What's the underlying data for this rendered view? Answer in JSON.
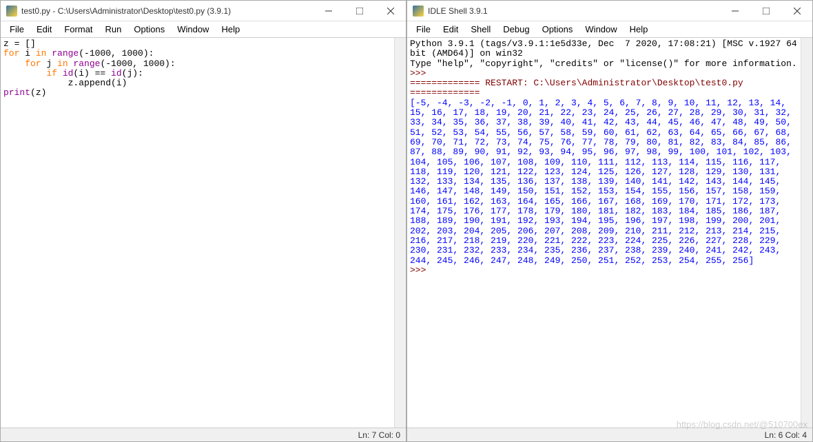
{
  "left_window": {
    "title": "test0.py - C:\\Users\\Administrator\\Desktop\\test0.py (3.9.1)",
    "menu": [
      "File",
      "Edit",
      "Format",
      "Run",
      "Options",
      "Window",
      "Help"
    ],
    "status": "Ln: 7  Col: 0",
    "code": {
      "l1": {
        "a": "z = []"
      },
      "l2": {
        "a": "for",
        "b": " i ",
        "c": "in",
        "d": " range",
        "e": "(-1000, 1000):"
      },
      "l3": {
        "a": "    for",
        "b": " j ",
        "c": "in",
        "d": " range",
        "e": "(-1000, 1000):"
      },
      "l4": {
        "a": "        if",
        "b": " id",
        "c": "(i) == ",
        "d": "id",
        "e": "(j):"
      },
      "l5": {
        "a": "            z.append(i)"
      },
      "l6": {
        "a": "print",
        "b": "(z)"
      }
    }
  },
  "right_window": {
    "title": "IDLE Shell 3.9.1",
    "menu": [
      "File",
      "Edit",
      "Shell",
      "Debug",
      "Options",
      "Window",
      "Help"
    ],
    "status": "Ln: 6  Col: 4",
    "banner_l1": "Python 3.9.1 (tags/v3.9.1:1e5d33e, Dec  7 2020, 17:08:21) [MSC v.1927 64 bit (AMD64)] on win32",
    "banner_l2": "Type \"help\", \"copyright\", \"credits\" or \"license()\" for more information.",
    "prompt": ">>>",
    "restart_label": "============= RESTART: C:\\Users\\Administrator\\Desktop\\test0.py =============",
    "output": "[-5, -4, -3, -2, -1, 0, 1, 2, 3, 4, 5, 6, 7, 8, 9, 10, 11, 12, 13, 14, 15, 16, 17, 18, 19, 20, 21, 22, 23, 24, 25, 26, 27, 28, 29, 30, 31, 32, 33, 34, 35, 36, 37, 38, 39, 40, 41, 42, 43, 44, 45, 46, 47, 48, 49, 50, 51, 52, 53, 54, 55, 56, 57, 58, 59, 60, 61, 62, 63, 64, 65, 66, 67, 68, 69, 70, 71, 72, 73, 74, 75, 76, 77, 78, 79, 80, 81, 82, 83, 84, 85, 86, 87, 88, 89, 90, 91, 92, 93, 94, 95, 96, 97, 98, 99, 100, 101, 102, 103, 104, 105, 106, 107, 108, 109, 110, 111, 112, 113, 114, 115, 116, 117, 118, 119, 120, 121, 122, 123, 124, 125, 126, 127, 128, 129, 130, 131, 132, 133, 134, 135, 136, 137, 138, 139, 140, 141, 142, 143, 144, 145, 146, 147, 148, 149, 150, 151, 152, 153, 154, 155, 156, 157, 158, 159, 160, 161, 162, 163, 164, 165, 166, 167, 168, 169, 170, 171, 172, 173, 174, 175, 176, 177, 178, 179, 180, 181, 182, 183, 184, 185, 186, 187, 188, 189, 190, 191, 192, 193, 194, 195, 196, 197, 198, 199, 200, 201, 202, 203, 204, 205, 206, 207, 208, 209, 210, 211, 212, 213, 214, 215, 216, 217, 218, 219, 220, 221, 222, 223, 224, 225, 226, 227, 228, 229, 230, 231, 232, 233, 234, 235, 236, 237, 238, 239, 240, 241, 242, 243, 244, 245, 246, 247, 248, 249, 250, 251, 252, 253, 254, 255, 256]"
  },
  "watermark": "https://blog.csdn.net/@510700ex"
}
